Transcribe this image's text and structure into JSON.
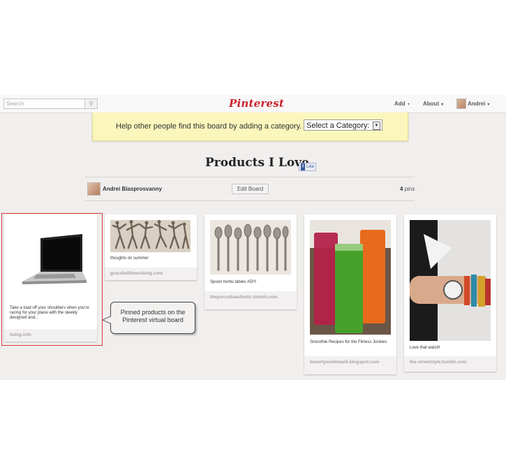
{
  "header": {
    "search_placeholder": "Search",
    "logo": "Pinterest",
    "nav": [
      {
        "label": "Add",
        "suffix": "+"
      },
      {
        "label": "About",
        "suffix": "▾"
      },
      {
        "label": "Andrei",
        "suffix": "▾"
      }
    ]
  },
  "banner": {
    "text": "Help other people find this board by adding a category.",
    "select_value": "Select a Category:"
  },
  "board": {
    "title": "Products I Love",
    "like_label": "Like",
    "owner": "Andrei Biasprosvanny",
    "edit_label": "Edit Board",
    "pins_count": "4",
    "pins_word": "pins"
  },
  "pins": [
    {
      "desc": "Take a load off your shoulders when you're racing for your plane with the sleekly designed and...",
      "source": "belvg.info"
    },
    {
      "desc": "thoughts on summer",
      "source": "gracefulfitnessblog.com"
    },
    {
      "desc": "Spoon herbs labels #DIY",
      "source": "thepursuitaesthetic.tumblr.com"
    },
    {
      "desc": "Smoothie Recipes for the Fitness Junkies",
      "source": "beverlyworkman5.blogspot.com"
    },
    {
      "desc": "Love that watch!",
      "source": "the-streetstyle.tumblr.com"
    }
  ],
  "callout": {
    "line1": "Pinned products on the",
    "line2": "Pinterest virtual board"
  },
  "colors": {
    "brand": "#c8232c",
    "banner": "#fbf7bc",
    "highlight": "#d9373a"
  }
}
